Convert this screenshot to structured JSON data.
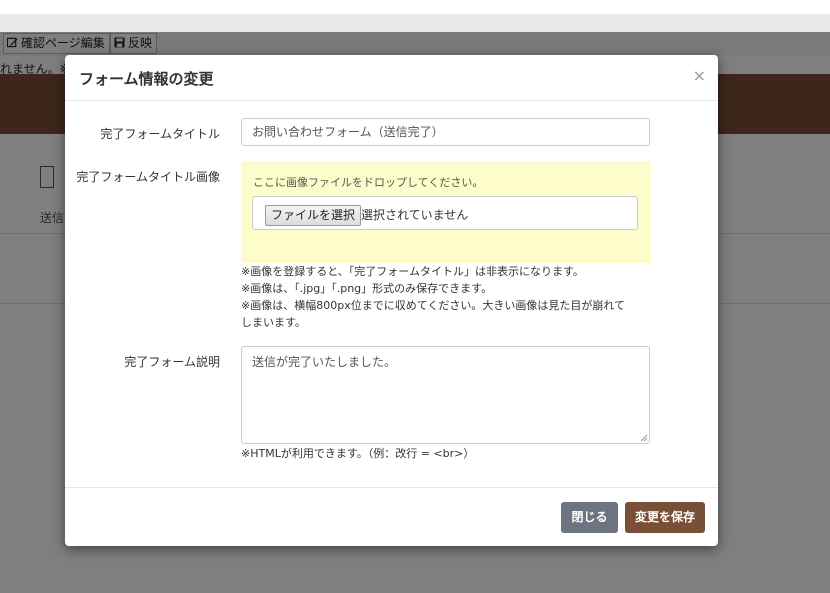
{
  "background": {
    "toolbar": {
      "confirm_edit_label": "確認ページ編集",
      "reflect_label": "反映"
    },
    "notice_text": "れません。※",
    "section_label": "送信"
  },
  "modal": {
    "title": "フォーム情報の変更",
    "close_symbol": "×",
    "fields": {
      "title_label": "完了フォームタイトル",
      "title_value": "お問い合わせフォーム（送信完了）",
      "image_label": "完了フォームタイトル画像",
      "dropzone_text": "ここに画像ファイルをドロップしてください。",
      "file_button_label": "ファイルを選択",
      "file_status": "選択されていません",
      "image_notes": [
        "※画像を登録すると、「完了フォームタイトル」は非表示になります。",
        "※画像は、「.jpg」「.png」形式のみ保存できます。",
        "※画像は、横幅800px位までに収めてください。大きい画像は見た目が崩れて",
        "しまいます。"
      ],
      "description_label": "完了フォーム説明",
      "description_value": "送信が完了いたしました。",
      "description_note": "※HTMLが利用できます。（例：改行 = <br>）"
    },
    "footer": {
      "close_label": "閉じる",
      "save_label": "変更を保存"
    }
  },
  "colors": {
    "brand_brown": "#7a4f37",
    "close_button_gray": "#6b7480",
    "dropzone_yellow": "#fdfdcc"
  }
}
